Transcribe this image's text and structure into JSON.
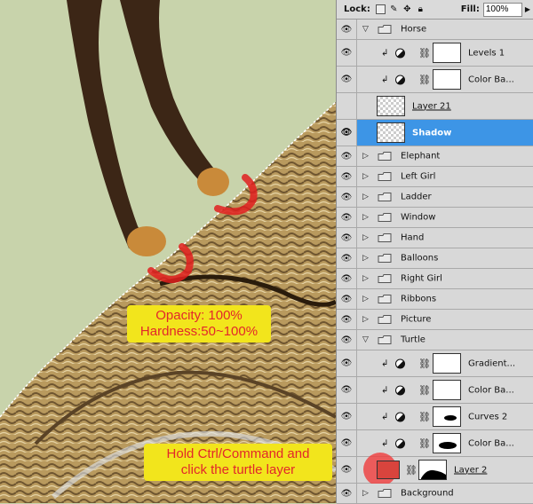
{
  "toolbar": {
    "lock_label": "Lock:",
    "fill_label": "Fill:",
    "fill_value": "100%",
    "icons": [
      "lock-transparent-icon",
      "lock-paint-icon",
      "lock-move-icon",
      "lock-all-icon"
    ]
  },
  "annotations": {
    "brush_line1": "Opacity: 100%",
    "brush_line2": "Hardness:50~100%",
    "ctrl_line1": "Hold Ctrl/Command and",
    "ctrl_line2": "click the turtle layer"
  },
  "layers": {
    "horse": "Horse",
    "levels1": "Levels 1",
    "colorbal_horse": "Color Ba...",
    "layer21": "Layer 21",
    "shadow": "Shadow",
    "elephant": "Elephant",
    "left_girl": "Left Girl",
    "ladder": "Ladder",
    "window": "Window",
    "hand": "Hand",
    "balloons": "Balloons",
    "right_girl": "Right Girl",
    "ribbons": "Ribbons",
    "picture": "Picture",
    "turtle": "Turtle",
    "gradient": "Gradient...",
    "colorbal_t1": "Color Ba...",
    "curves2": "Curves 2",
    "colorbal_t2": "Color Ba...",
    "layer2": "Layer 2",
    "background": "Background"
  },
  "colors": {
    "selection": "#3d95e6",
    "annotation_bg": "#f2e51c",
    "annotation_text": "#e2272b"
  }
}
